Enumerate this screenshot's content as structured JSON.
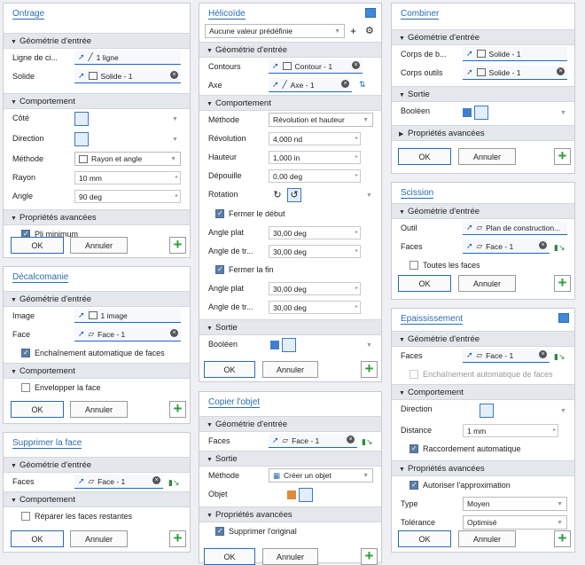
{
  "ontrage": {
    "title": "Ontrage",
    "sec_geom": "Géométrie d'entrée",
    "ligne_label": "Ligne de ci...",
    "ligne_value": "1 ligne",
    "solide_label": "Solide",
    "solide_value": "Solide - 1",
    "sec_comp": "Comportement",
    "cote": "Côté",
    "direction": "Direction",
    "methode_label": "Méthode",
    "methode_value": "Rayon et angle",
    "rayon_label": "Rayon",
    "rayon_value": "10 mm",
    "angle_label": "Angle",
    "angle_value": "90 deg",
    "sec_adv": "Propriétés avancées",
    "pli": "Pli minimum",
    "ok": "OK",
    "annuler": "Annuler"
  },
  "decal": {
    "title": "Décalcomanie",
    "sec_geom": "Géométrie d'entrée",
    "image_label": "Image",
    "image_value": "1 image",
    "face_label": "Face",
    "face_value": "Face - 1",
    "enchain": "Enchaînement automatique de faces",
    "sec_comp": "Comportement",
    "envelopper": "Envelopper la face",
    "ok": "OK",
    "annuler": "Annuler"
  },
  "suppr": {
    "title": "Supprimer la face",
    "sec_geom": "Géométrie d'entrée",
    "faces_label": "Faces",
    "faces_value": "Face - 1",
    "sec_comp": "Comportement",
    "reparer": "Réparer les faces restantes",
    "ok": "OK",
    "annuler": "Annuler"
  },
  "helic": {
    "title": "Hélicoïde",
    "preset": "Aucune valeur prédéfinie",
    "sec_geom": "Géométrie d'entrée",
    "contours_label": "Contours",
    "contours_value": "Contour - 1",
    "axe_label": "Axe",
    "axe_value": "Axe - 1",
    "sec_comp": "Comportement",
    "methode_label": "Méthode",
    "methode_value": "Révolution et hauteur",
    "revolution_label": "Révolution",
    "revolution_value": "4,000 nd",
    "hauteur_label": "Hauteur",
    "hauteur_value": "1,000 in",
    "depouille_label": "Dépouille",
    "depouille_value": "0,00 deg",
    "rotation_label": "Rotation",
    "fermer_debut": "Fermer le début",
    "angle_plat_label": "Angle plat",
    "angle_plat_value": "30,00 deg",
    "angle_tr_label": "Angle de tr...",
    "angle_tr_value": "30,00 deg",
    "fermer_fin": "Fermer la fin",
    "angle_plat2_value": "30,00 deg",
    "angle_tr2_value": "30,00 deg",
    "sec_sortie": "Sortie",
    "booleen": "Booléen",
    "ok": "OK",
    "annuler": "Annuler"
  },
  "copier": {
    "title": "Copier l'objet",
    "sec_geom": "Géométrie d'entrée",
    "faces_label": "Faces",
    "faces_value": "Face - 1",
    "sec_sortie": "Sortie",
    "methode_label": "Méthode",
    "methode_value": "Créer un objet",
    "objet_label": "Objet",
    "sec_adv": "Propriétés avancées",
    "supprimer": "Supprimer l'original",
    "ok": "OK",
    "annuler": "Annuler"
  },
  "combiner": {
    "title": "Combiner",
    "sec_geom": "Géométrie d'entrée",
    "corps_b_label": "Corps de b...",
    "corps_b_value": "Solide - 1",
    "corps_o_label": "Corps outils",
    "corps_o_value": "Solide - 1",
    "sec_sortie": "Sortie",
    "booleen": "Booléen",
    "sec_adv": "Propriétés avancées",
    "ok": "OK",
    "annuler": "Annuler"
  },
  "scission": {
    "title": "Scission",
    "sec_geom": "Géométrie d'entrée",
    "outil_label": "Outil",
    "outil_value": "Plan de construction...",
    "faces_label": "Faces",
    "faces_value": "Face - 1",
    "toutes": "Toutes les faces",
    "ok": "OK",
    "annuler": "Annuler"
  },
  "epais": {
    "title": "Epaississement",
    "sec_geom": "Géométrie d'entrée",
    "faces_label": "Faces",
    "faces_value": "Face - 1",
    "enchain": "Enchaînement automatique de faces",
    "sec_comp": "Comportement",
    "direction": "Direction",
    "distance_label": "Distance",
    "distance_value": "1 mm",
    "raccord": "Raccordement automatique",
    "sec_adv": "Propriétés avancées",
    "autoriser": "Autoriser l'approximation",
    "type_label": "Type",
    "type_value": "Moyen",
    "tol_label": "Tolérance",
    "tol_value": "Optimisé",
    "ok": "OK",
    "annuler": "Annuler"
  }
}
